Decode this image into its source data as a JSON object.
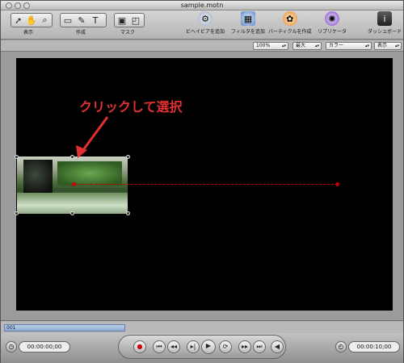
{
  "window": {
    "title": "sample.motn"
  },
  "toolbar": {
    "groups": [
      {
        "label": "表示"
      },
      {
        "label": "作成"
      },
      {
        "label": "マスク"
      }
    ],
    "actions": [
      {
        "label": "ビヘイビアを追加"
      },
      {
        "label": "フィルタを追加"
      },
      {
        "label": "パーティクルを作成"
      },
      {
        "label": "リプリケータ"
      },
      {
        "label": "ダッシュボード"
      }
    ]
  },
  "options": {
    "zoom": "100%",
    "quality": "最大",
    "color": "カラー",
    "view": "表示"
  },
  "annotation": {
    "text": "クリックして選択"
  },
  "timeline": {
    "start_frame": "001"
  },
  "transport": {
    "current_time": "00:00:00;00",
    "duration": "00:00:10;00"
  }
}
